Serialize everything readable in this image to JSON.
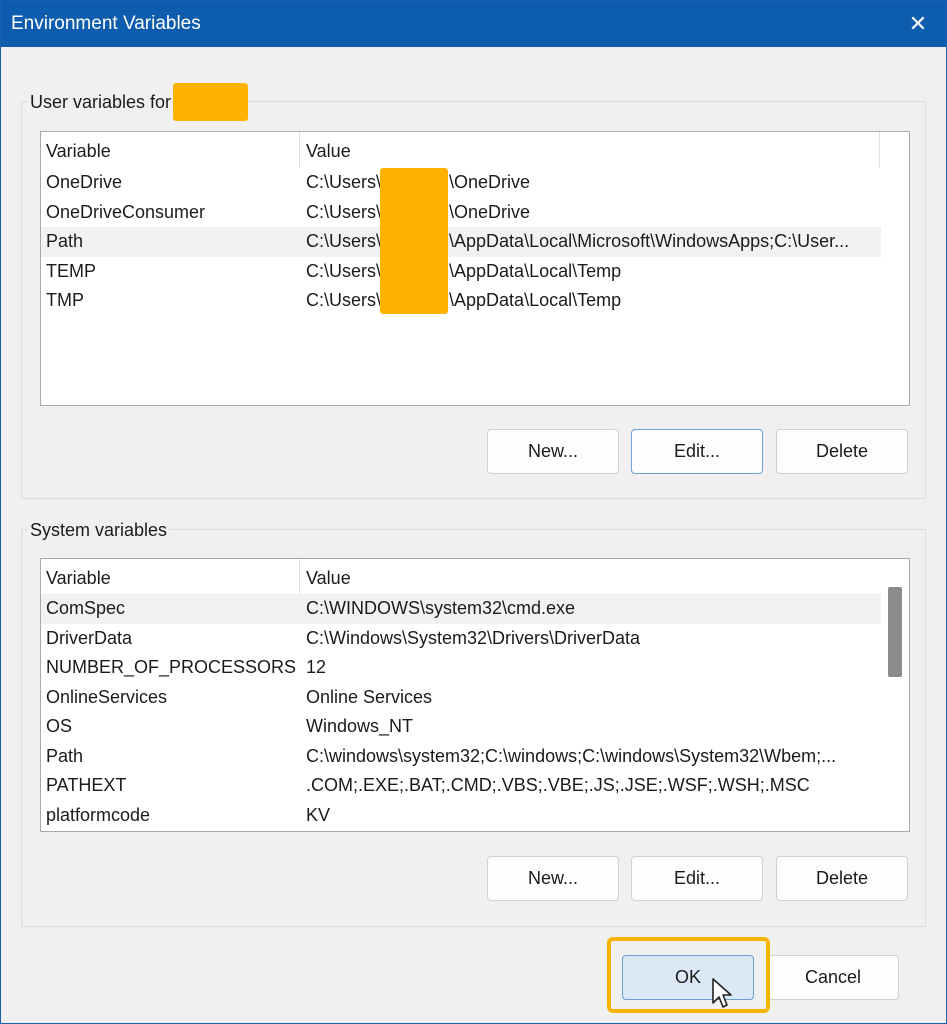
{
  "window": {
    "title": "Environment Variables",
    "close_glyph": "✕"
  },
  "user_section": {
    "label": "User variables for",
    "columns": {
      "variable": "Variable",
      "value": "Value"
    },
    "rows": [
      {
        "variable": "OneDrive",
        "value_prefix": "C:\\Users\\",
        "value_suffix": "\\OneDrive"
      },
      {
        "variable": "OneDriveConsumer",
        "value_prefix": "C:\\Users\\",
        "value_suffix": "\\OneDrive"
      },
      {
        "variable": "Path",
        "value_prefix": "C:\\Users\\",
        "value_suffix": "\\AppData\\Local\\Microsoft\\WindowsApps;C:\\User..."
      },
      {
        "variable": "TEMP",
        "value_prefix": "C:\\Users\\",
        "value_suffix": "\\AppData\\Local\\Temp"
      },
      {
        "variable": "TMP",
        "value_prefix": "C:\\Users\\",
        "value_suffix": "\\AppData\\Local\\Temp"
      }
    ],
    "buttons": {
      "new": "New...",
      "edit": "Edit...",
      "delete": "Delete"
    }
  },
  "system_section": {
    "label": "System variables",
    "columns": {
      "variable": "Variable",
      "value": "Value"
    },
    "rows": [
      {
        "variable": "ComSpec",
        "value": "C:\\WINDOWS\\system32\\cmd.exe"
      },
      {
        "variable": "DriverData",
        "value": "C:\\Windows\\System32\\Drivers\\DriverData"
      },
      {
        "variable": "NUMBER_OF_PROCESSORS",
        "value": "12"
      },
      {
        "variable": "OnlineServices",
        "value": "Online Services"
      },
      {
        "variable": "OS",
        "value": "Windows_NT"
      },
      {
        "variable": "Path",
        "value": "C:\\windows\\system32;C:\\windows;C:\\windows\\System32\\Wbem;..."
      },
      {
        "variable": "PATHEXT",
        "value": ".COM;.EXE;.BAT;.CMD;.VBS;.VBE;.JS;.JSE;.WSF;.WSH;.MSC"
      },
      {
        "variable": "platformcode",
        "value": "KV"
      }
    ],
    "buttons": {
      "new": "New...",
      "edit": "Edit...",
      "delete": "Delete"
    }
  },
  "footer": {
    "ok": "OK",
    "cancel": "Cancel"
  },
  "colors": {
    "titlebar": "#0e5cad",
    "redaction": "#ffb300",
    "highlight": "#f4b400"
  }
}
